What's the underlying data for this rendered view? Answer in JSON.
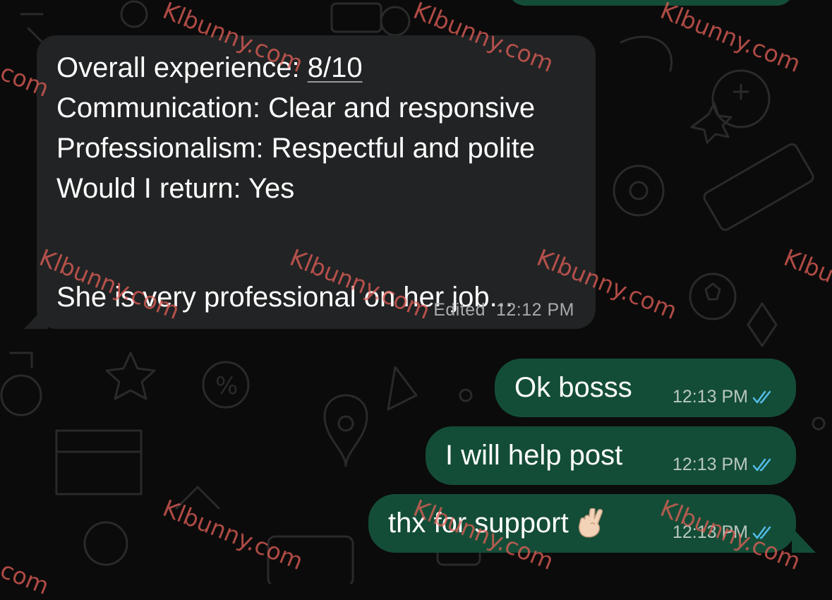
{
  "incoming_message": {
    "lines": [
      {
        "label": "Overall experience:",
        "value": "8/10"
      },
      {
        "label": "Communication:",
        "value": "Clear and responsive"
      },
      {
        "label": "Professionalism:",
        "value": "Respectful and polite"
      },
      {
        "label": "Would I return:",
        "value": "Yes"
      }
    ],
    "body": "She is very professional on her job...",
    "edited_label": "Edited",
    "time": "12:12 PM"
  },
  "outgoing_messages": [
    {
      "text": "Ok bosss",
      "time": "12:13 PM",
      "status": "read"
    },
    {
      "text": "I will help post",
      "time": "12:13 PM",
      "status": "read"
    },
    {
      "text": "thx for support",
      "emoji": "crossed-fingers",
      "time": "12:13 PM",
      "status": "read"
    }
  ],
  "watermark": {
    "text": "Klbunny.com",
    "color": "#e56058"
  },
  "colors": {
    "background": "#0b0b0b",
    "incoming_bubble": "#222324",
    "outgoing_bubble": "#144d37",
    "read_receipt": "#53bdeb"
  }
}
